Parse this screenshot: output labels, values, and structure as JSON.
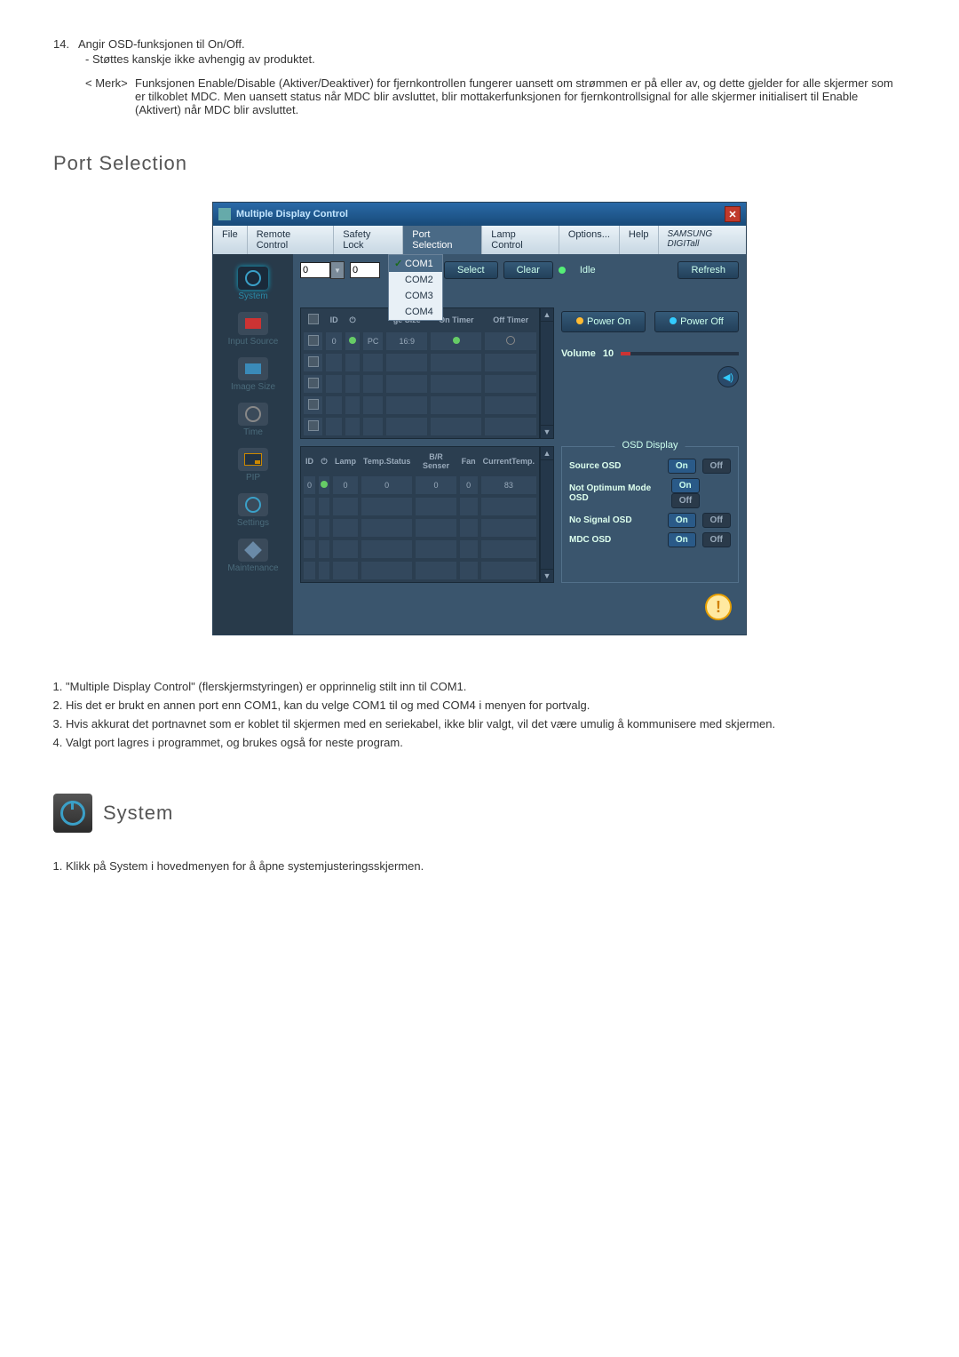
{
  "doc": {
    "item14_num": "14.",
    "item14_line1": "Angir OSD-funksjonen til On/Off.",
    "item14_dash": "- Støttes kanskje ikke avhengig av produktet.",
    "merk_label": "< Merk>",
    "merk_body": "Funksjonen Enable/Disable (Aktiver/Deaktiver) for fjernkontrollen fungerer uansett om strømmen er på eller av, og dette gjelder for alle skjermer som er tilkoblet MDC. Men uansett status når MDC blir avsluttet, blir mottakerfunksjonen for fjernkontrollsignal for alle skjermer initialisert til Enable (Aktivert) når MDC blir avsluttet.",
    "h_port": "Port Selection",
    "h_system": "System",
    "notes": [
      "\"Multiple Display Control\" (flerskjermstyringen) er opprinnelig stilt inn til COM1.",
      "His det er brukt en annen port enn COM1, kan du velge COM1 til og med COM4 i menyen for portvalg.",
      "Hvis akkurat det portnavnet som er koblet til skjermen med en seriekabel, ikke blir valgt, vil det være umulig å kommunisere med skjermen.",
      "Valgt port lagres i programmet, og brukes også for neste program."
    ],
    "system_note": "Klikk på System i hovedmenyen for å åpne systemjusteringsskjermen."
  },
  "app": {
    "title": "Multiple Display Control",
    "menu": {
      "file": "File",
      "remote": "Remote Control",
      "safety": "Safety Lock",
      "port": "Port Selection",
      "lamp": "Lamp Control",
      "options": "Options...",
      "help": "Help",
      "brand": "SAMSUNG DIGITall"
    },
    "ports": {
      "p1": "COM1",
      "p2": "COM2",
      "p3": "COM3",
      "p4": "COM4"
    },
    "sidebar": {
      "system": "System",
      "input": "Input Source",
      "image": "Image Size",
      "time": "Time",
      "pip": "PIP",
      "settings": "Settings",
      "maint": "Maintenance"
    },
    "top": {
      "spin1": "0",
      "spin2": "0",
      "select": "Select",
      "clear": "Clear",
      "idle": "Idle",
      "refresh": "Refresh"
    },
    "table1": {
      "h_id": "ID",
      "h_pc": "ge Size",
      "h_on": "On Timer",
      "h_off": "Off Timer",
      "r_id": "0",
      "r_pc": "PC",
      "r_size": "16:9"
    },
    "power": {
      "on": "Power On",
      "off": "Power Off"
    },
    "volume": {
      "label": "Volume",
      "value": "10"
    },
    "table2": {
      "h_id": "ID",
      "h_lamp": "Lamp",
      "h_temp": "Temp.Status",
      "h_br": "B/R Senser",
      "h_fan": "Fan",
      "h_cur": "CurrentTemp.",
      "r_id": "0",
      "r_lamp": "0",
      "r_temp": "0",
      "r_br": "0",
      "r_fan": "0",
      "r_cur": "83"
    },
    "osd": {
      "legend": "OSD Display",
      "source": "Source OSD",
      "notopt": "Not Optimum Mode OSD",
      "nosig": "No Signal OSD",
      "mdc": "MDC OSD",
      "on": "On",
      "off": "Off"
    }
  }
}
